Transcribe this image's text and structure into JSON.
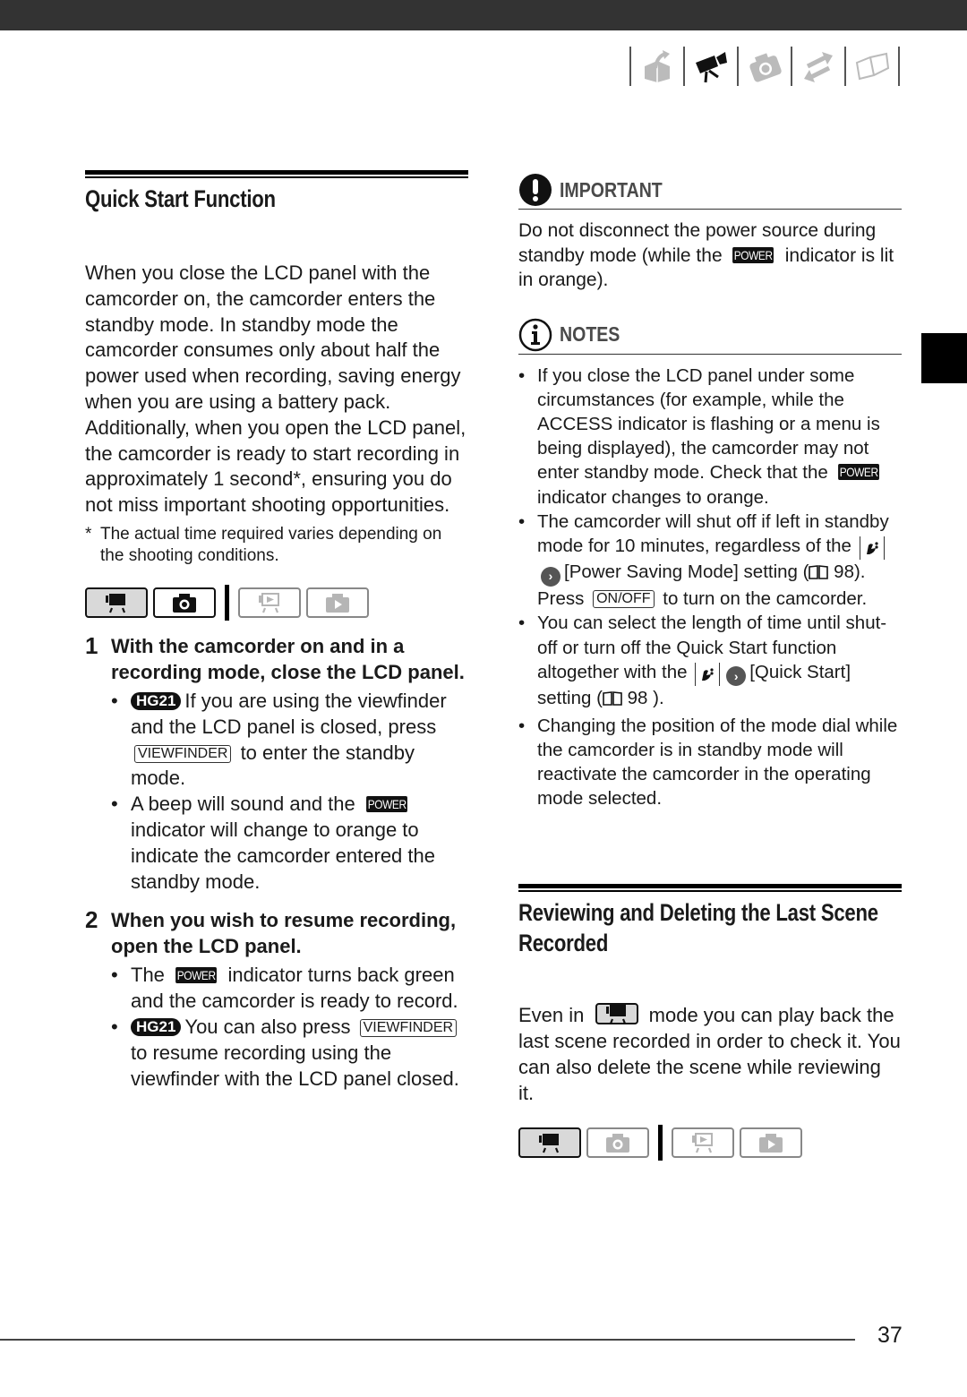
{
  "nav_icons": [
    "preparations-icon",
    "video-icon",
    "photo-icon",
    "external-connections-icon",
    "additional-info-icon"
  ],
  "left": {
    "section_title": "Quick Start Function",
    "intro": "When you close the LCD panel with the camcorder on, the camcorder enters the standby mode. In standby mode the camcorder consumes only about half the power used when recording, saving energy when you are using a battery pack. Additionally, when you open the LCD panel, the camcorder is ready to start recording in approximately 1 second*, ensuring you do not miss important shooting opportunities.",
    "footnote_mark": "*",
    "footnote": "The actual time required varies depending on the shooting conditions.",
    "modes": [
      {
        "name": "movie-record",
        "active": true
      },
      {
        "name": "photo-record",
        "active": true
      },
      {
        "name": "movie-playback",
        "active": false
      },
      {
        "name": "photo-playback",
        "active": false
      }
    ],
    "steps": [
      {
        "num": "1",
        "text": "With the camcorder on and in a recording mode, close the LCD panel.",
        "bullets": [
          {
            "badge": "HG21",
            "pre": "If you are using the viewfinder and the LCD panel is closed, press",
            "key": "VIEWFINDER",
            "post": "to enter the standby mode."
          },
          {
            "pre": "A beep will sound and the",
            "power": "POWER",
            "post": "indicator will change to orange to indicate the camcorder entered the standby mode."
          }
        ]
      },
      {
        "num": "2",
        "text": "When you wish to resume recording, open the LCD panel.",
        "bullets": [
          {
            "pre": "The",
            "power": "POWER",
            "post": "indicator turns back green and the camcorder is ready to record."
          },
          {
            "badge": "HG21",
            "pre": "You can also press",
            "key": "VIEWFINDER",
            "post": "to resume recording using the viewfinder with the LCD panel closed."
          }
        ]
      }
    ]
  },
  "right": {
    "important": {
      "label": "IMPORTANT",
      "pre": "Do not disconnect the power source during standby mode (while the",
      "power": "POWER",
      "post": "indicator is lit in orange)."
    },
    "notes": {
      "label": "NOTES",
      "items": [
        {
          "pre": "If you close the LCD panel under some circumstances (for example, while the ACCESS indicator is flashing or a menu is being displayed), the camcorder may not enter standby mode. Check that the",
          "power": "POWER",
          "post": "indicator changes to orange."
        },
        {
          "pre": "The camcorder will shut off if left in standby mode for 10 minutes, regardless of the",
          "menu_item": "[Power Saving Mode]",
          "mid": "setting (",
          "page_ref": "98",
          "mid2": "). Press",
          "key": "ON/OFF",
          "post": "to turn on the camcorder."
        },
        {
          "pre": "You can select the length of time until shut-off or turn off the Quick Start function altogether with the",
          "menu_item": "[Quick Start]",
          "mid": "setting (",
          "page_ref": "98",
          "post": ")."
        },
        {
          "pre": "Changing the position of the mode dial while the camcorder is in standby mode will reactivate the camcorder in the operating mode selected."
        }
      ]
    },
    "section2": {
      "title": "Reviewing and Deleting the Last Scene Recorded",
      "pre": "Even in",
      "post": "mode you can play back the last scene recorded in order to check it. You can also delete the scene while reviewing it.",
      "modes": [
        {
          "name": "movie-record",
          "active": true
        },
        {
          "name": "photo-record",
          "active": false
        },
        {
          "name": "movie-playback",
          "active": false
        },
        {
          "name": "photo-playback",
          "active": false
        }
      ]
    }
  },
  "page_number": "37"
}
